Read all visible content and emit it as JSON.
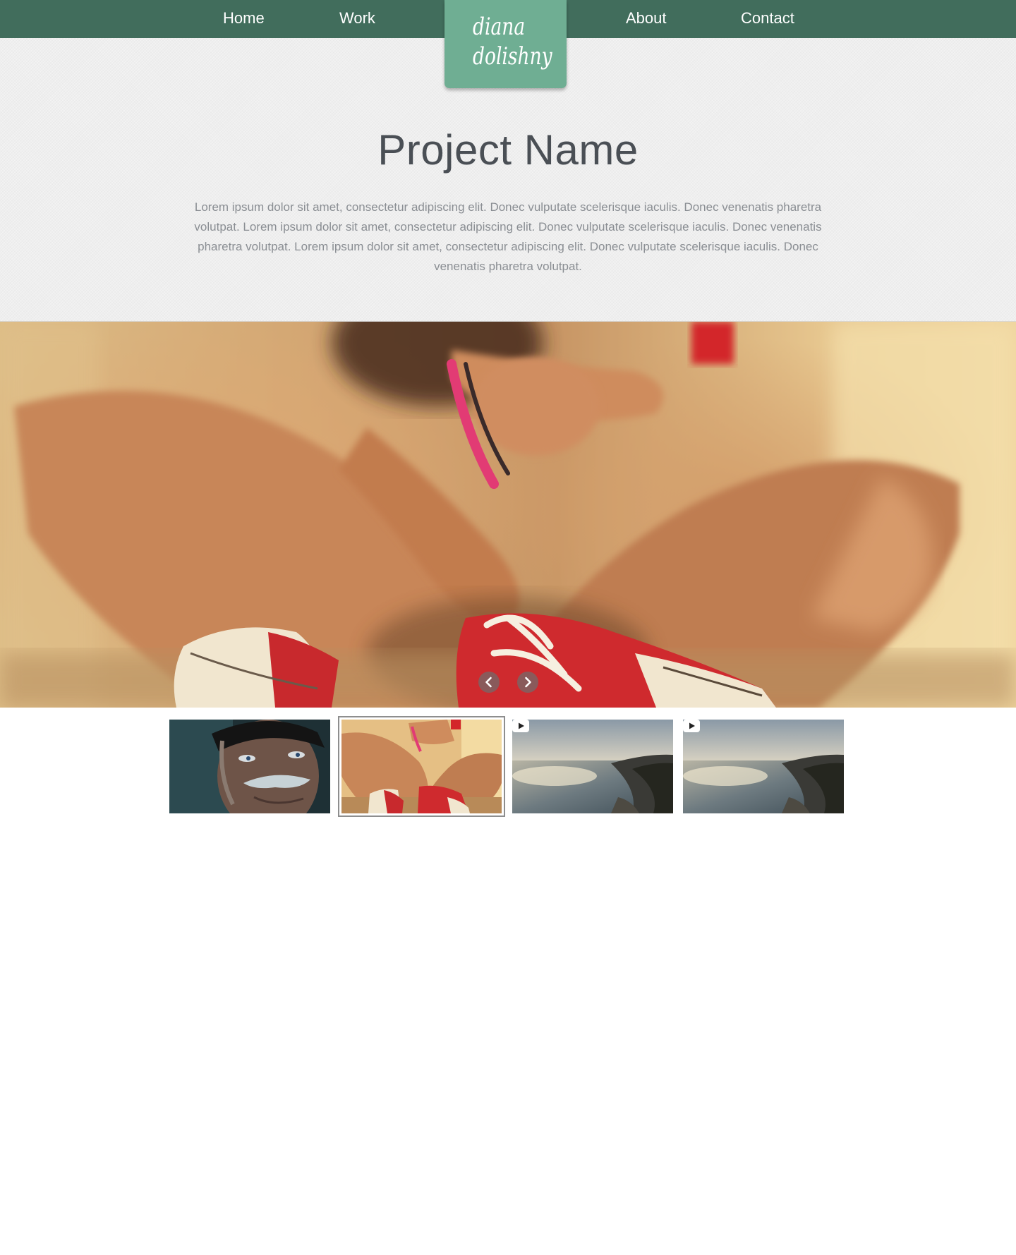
{
  "nav": {
    "left_items": [
      {
        "label": "Home"
      },
      {
        "label": "Work"
      }
    ],
    "right_items": [
      {
        "label": "About"
      },
      {
        "label": "Contact"
      }
    ],
    "logo": {
      "line1": "diana",
      "line2": "dolishny"
    }
  },
  "hero": {
    "title": "Project Name",
    "description": "Lorem ipsum dolor sit amet, consectetur adipiscing elit. Donec vulputate scelerisque iaculis. Donec venenatis pharetra volutpat. Lorem ipsum dolor sit amet, consectetur adipiscing elit. Donec vulputate scelerisque iaculis. Donec venenatis pharetra volutpat. Lorem ipsum dolor sit amet, consectetur adipiscing elit. Donec vulputate scelerisque iaculis. Donec venenatis pharetra volutpat."
  },
  "slider": {
    "prev_icon": "chevron-left-icon",
    "next_icon": "chevron-right-icon"
  },
  "thumbnails": [
    {
      "subject": "portrait",
      "type": "image",
      "selected": false
    },
    {
      "subject": "sneakers",
      "type": "image",
      "selected": true
    },
    {
      "subject": "coastline",
      "type": "video",
      "selected": false
    },
    {
      "subject": "coastline",
      "type": "video",
      "selected": false
    }
  ],
  "colors": {
    "nav_bg": "#416d5c",
    "logo_bg": "#6fae93",
    "title": "#4a4f55",
    "body_text": "#8a8e93"
  }
}
